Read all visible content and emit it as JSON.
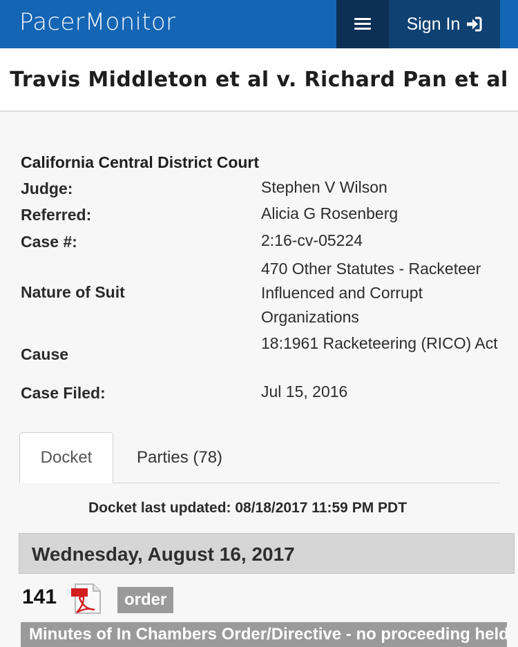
{
  "header": {
    "brand": "PacerMonitor",
    "menu_icon": "hamburger-menu-icon",
    "signin_label": "Sign In",
    "signin_icon": "sign-in-arrow-icon",
    "colors": {
      "bar": "#1565b5",
      "menu": "#0c2f55",
      "signin": "#0f4172"
    }
  },
  "case": {
    "title": "Travis Middleton et al v. Richard Pan et al",
    "court": "California Central District Court",
    "fields": [
      {
        "label": "Judge:",
        "value": "Stephen V Wilson"
      },
      {
        "label": "Referred:",
        "value": "Alicia G Rosenberg"
      },
      {
        "label": "Case #:",
        "value": "2:16-cv-05224"
      },
      {
        "label": "Nature of Suit",
        "value": "470 Other Statutes - Racketeer Influenced and Corrupt Organizations"
      },
      {
        "label": "Cause",
        "value": "18:1961 Racketeering (RICO) Act"
      },
      {
        "label": "Case Filed:",
        "value": "Jul 15, 2016"
      }
    ]
  },
  "tabs": [
    {
      "label": "Docket",
      "active": true
    },
    {
      "label": "Parties (78)",
      "active": false
    }
  ],
  "docket": {
    "last_updated": "Docket last updated: 08/18/2017 11:59 PM PDT",
    "date_heading": "Wednesday, August 16, 2017",
    "entry": {
      "number": "141",
      "icon": "pdf-icon",
      "tag": "order",
      "description": "Minutes of In Chambers Order/Directive - no proceeding held"
    }
  }
}
